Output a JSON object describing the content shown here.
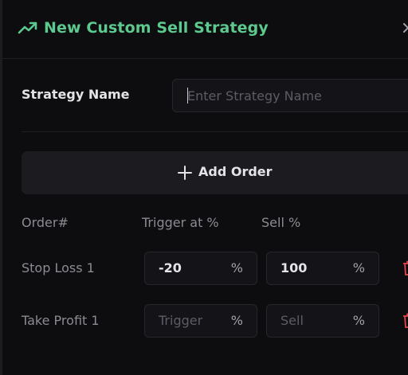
{
  "header": {
    "title": "New Custom Sell Strategy",
    "icon": "trending-up-icon",
    "accent_color": "#5cc98e",
    "close_icon": "close-icon"
  },
  "strategy_name": {
    "label": "Strategy Name",
    "value": "",
    "placeholder": "Enter Strategy Name"
  },
  "add_order": {
    "label": "Add Order",
    "icon": "plus-icon"
  },
  "orders_table": {
    "columns": [
      "Order#",
      "Trigger at %",
      "Sell %"
    ],
    "rows": [
      {
        "label": "Stop Loss 1",
        "trigger": "-20",
        "trigger_placeholder": "Trigger",
        "trigger_unit": "%",
        "sell": "100",
        "sell_placeholder": "Sell",
        "sell_unit": "%",
        "delete_icon": "trash-icon"
      },
      {
        "label": "Take Profit 1",
        "trigger": "",
        "trigger_placeholder": "Trigger",
        "trigger_unit": "%",
        "sell": "",
        "sell_placeholder": "Sell",
        "sell_unit": "%",
        "delete_icon": "trash-icon"
      }
    ]
  },
  "colors": {
    "background": "#0d0d10",
    "danger": "#e0464b"
  }
}
